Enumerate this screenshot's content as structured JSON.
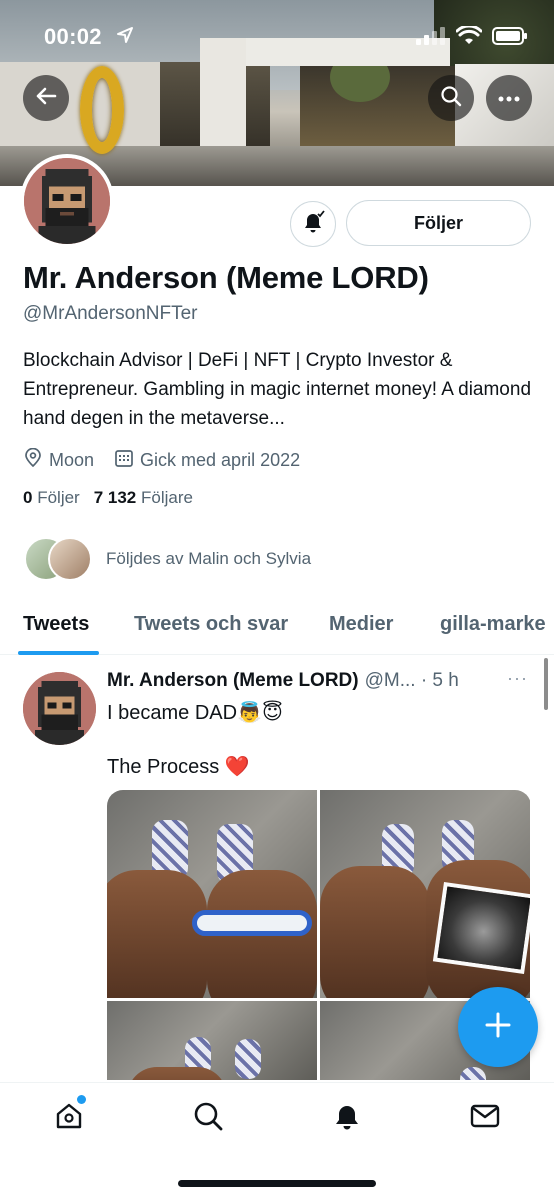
{
  "status_bar": {
    "time": "00:02"
  },
  "profile": {
    "name": "Mr. Anderson (Meme LORD)",
    "handle": "@MrAndersonNFTer",
    "bio": "Blockchain Advisor | DeFi | NFT | Crypto Investor & Entrepreneur. Gambling in magic internet money! A diamond hand degen in the metaverse...",
    "location": "Moon",
    "joined": "Gick med april 2022",
    "following_count": "0",
    "following_label": "Följer",
    "followers_count": "7 132",
    "followers_label": "Följare",
    "followed_by": "Följdes av Malin och Sylvia",
    "follow_button": "Följer"
  },
  "tabs": [
    {
      "label": "Tweets",
      "active": true
    },
    {
      "label": "Tweets och svar",
      "active": false
    },
    {
      "label": "Medier",
      "active": false
    },
    {
      "label": "gilla-marke",
      "active": false
    }
  ],
  "tweet": {
    "author": "Mr. Anderson (Meme LORD)",
    "handle_time": "@M... · 5 h",
    "more": "···",
    "line1": "I became DAD",
    "line1_emoji": "👼😇",
    "line2": "The Process",
    "line2_emoji": "❤️"
  },
  "icons": {
    "back": "back-arrow-icon",
    "search": "search-icon",
    "more": "more-icon",
    "bell": "bell-icon",
    "location": "location-pin-icon",
    "calendar": "calendar-icon",
    "compose": "plus-icon",
    "nav": [
      "home-icon",
      "search-icon",
      "bell-icon",
      "mail-icon"
    ]
  },
  "colors": {
    "accent": "#1d9bf0",
    "text": "#0f1419",
    "secondary": "#536471"
  }
}
